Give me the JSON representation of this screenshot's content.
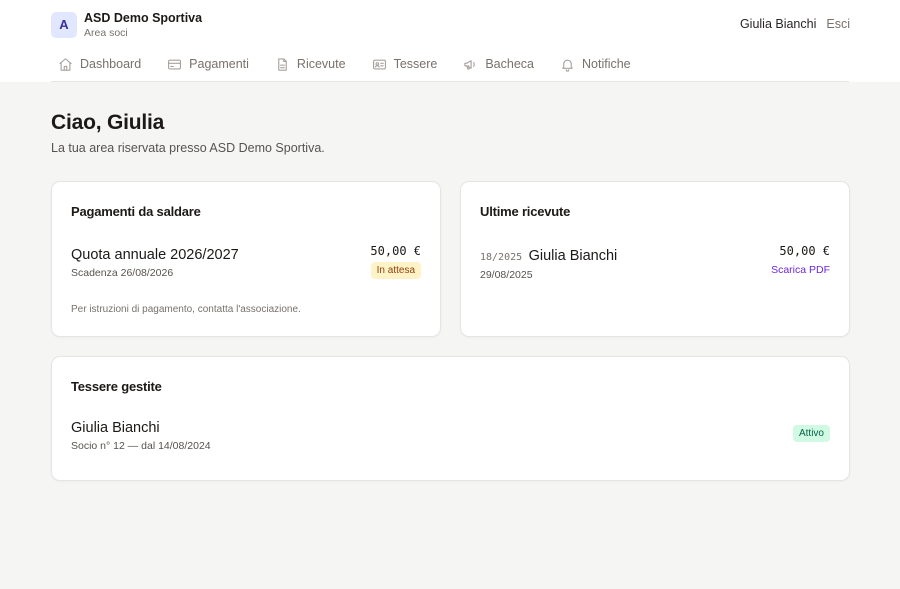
{
  "app": {
    "logo_letter": "A",
    "name": "ASD Demo Sportiva",
    "subtitle": "Area soci"
  },
  "user": {
    "name": "Giulia Bianchi",
    "logout_label": "Esci"
  },
  "nav": {
    "items": [
      {
        "label": "Dashboard",
        "icon": "home-icon"
      },
      {
        "label": "Pagamenti",
        "icon": "credit-card-icon"
      },
      {
        "label": "Ricevute",
        "icon": "file-icon"
      },
      {
        "label": "Tessere",
        "icon": "id-card-icon"
      },
      {
        "label": "Bacheca",
        "icon": "megaphone-icon"
      },
      {
        "label": "Notifiche",
        "icon": "bell-icon"
      }
    ]
  },
  "page": {
    "greeting": "Ciao, Giulia",
    "subtitle": "La tua area riservata presso ASD Demo Sportiva."
  },
  "payments": {
    "title": "Pagamenti da saldare",
    "item": {
      "title": "Quota annuale 2026/2027",
      "due": "Scadenza 26/08/2026",
      "amount": "50,00 €",
      "status": "In attesa"
    },
    "note": "Per istruzioni di pagamento, contatta l'associazione."
  },
  "receipts": {
    "title": "Ultime ricevute",
    "item": {
      "number": "18/2025",
      "name": "Giulia Bianchi",
      "date": "29/08/2025",
      "amount": "50,00 €",
      "download_label": "Scarica PDF"
    }
  },
  "cards": {
    "title": "Tessere gestite",
    "item": {
      "name": "Giulia Bianchi",
      "details": "Socio n° 12 — dal 14/08/2024",
      "status": "Attivo"
    }
  },
  "colors": {
    "accent": "#6d28d9",
    "pending_bg": "#fef3c7",
    "active_bg": "#d1fae5"
  }
}
